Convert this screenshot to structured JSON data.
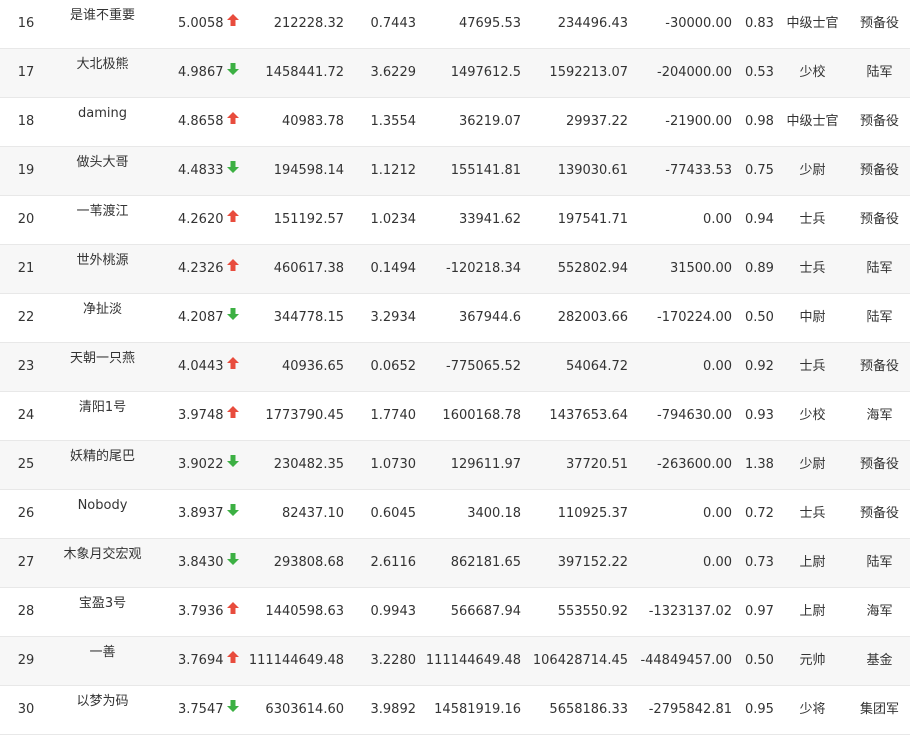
{
  "colors": {
    "up": "#e84c3d",
    "down": "#3cb043"
  },
  "rows": [
    {
      "rank": "16",
      "name": "是谁不重要",
      "score": "5.0058",
      "trend": "up",
      "assets": "212228.32",
      "ratio": "0.7443",
      "profit": "47695.53",
      "value": "234496.43",
      "flow": "-30000.00",
      "pos": "0.83",
      "rank_title": "中级士官",
      "unit": "预备役"
    },
    {
      "rank": "17",
      "name": "大北极熊",
      "score": "4.9867",
      "trend": "down",
      "assets": "1458441.72",
      "ratio": "3.6229",
      "profit": "1497612.5",
      "value": "1592213.07",
      "flow": "-204000.00",
      "pos": "0.53",
      "rank_title": "少校",
      "unit": "陆军"
    },
    {
      "rank": "18",
      "name": "daming",
      "score": "4.8658",
      "trend": "up",
      "assets": "40983.78",
      "ratio": "1.3554",
      "profit": "36219.07",
      "value": "29937.22",
      "flow": "-21900.00",
      "pos": "0.98",
      "rank_title": "中级士官",
      "unit": "预备役"
    },
    {
      "rank": "19",
      "name": "做头大哥",
      "score": "4.4833",
      "trend": "down",
      "assets": "194598.14",
      "ratio": "1.1212",
      "profit": "155141.81",
      "value": "139030.61",
      "flow": "-77433.53",
      "pos": "0.75",
      "rank_title": "少尉",
      "unit": "预备役"
    },
    {
      "rank": "20",
      "name": "一苇渡江",
      "score": "4.2620",
      "trend": "up",
      "assets": "151192.57",
      "ratio": "1.0234",
      "profit": "33941.62",
      "value": "197541.71",
      "flow": "0.00",
      "pos": "0.94",
      "rank_title": "士兵",
      "unit": "预备役"
    },
    {
      "rank": "21",
      "name": "世外桃源",
      "score": "4.2326",
      "trend": "up",
      "assets": "460617.38",
      "ratio": "0.1494",
      "profit": "-120218.34",
      "value": "552802.94",
      "flow": "31500.00",
      "pos": "0.89",
      "rank_title": "士兵",
      "unit": "陆军"
    },
    {
      "rank": "22",
      "name": "净扯淡",
      "score": "4.2087",
      "trend": "down",
      "assets": "344778.15",
      "ratio": "3.2934",
      "profit": "367944.6",
      "value": "282003.66",
      "flow": "-170224.00",
      "pos": "0.50",
      "rank_title": "中尉",
      "unit": "陆军"
    },
    {
      "rank": "23",
      "name": "天朝一只燕",
      "score": "4.0443",
      "trend": "up",
      "assets": "40936.65",
      "ratio": "0.0652",
      "profit": "-775065.52",
      "value": "54064.72",
      "flow": "0.00",
      "pos": "0.92",
      "rank_title": "士兵",
      "unit": "预备役"
    },
    {
      "rank": "24",
      "name": "清阳1号",
      "score": "3.9748",
      "trend": "up",
      "assets": "1773790.45",
      "ratio": "1.7740",
      "profit": "1600168.78",
      "value": "1437653.64",
      "flow": "-794630.00",
      "pos": "0.93",
      "rank_title": "少校",
      "unit": "海军"
    },
    {
      "rank": "25",
      "name": "妖精的尾巴",
      "score": "3.9022",
      "trend": "down",
      "assets": "230482.35",
      "ratio": "1.0730",
      "profit": "129611.97",
      "value": "37720.51",
      "flow": "-263600.00",
      "pos": "1.38",
      "rank_title": "少尉",
      "unit": "预备役"
    },
    {
      "rank": "26",
      "name": "Nobody",
      "score": "3.8937",
      "trend": "down",
      "assets": "82437.10",
      "ratio": "0.6045",
      "profit": "3400.18",
      "value": "110925.37",
      "flow": "0.00",
      "pos": "0.72",
      "rank_title": "士兵",
      "unit": "预备役"
    },
    {
      "rank": "27",
      "name": "木象月交宏观",
      "score": "3.8430",
      "trend": "down",
      "assets": "293808.68",
      "ratio": "2.6116",
      "profit": "862181.65",
      "value": "397152.22",
      "flow": "0.00",
      "pos": "0.73",
      "rank_title": "上尉",
      "unit": "陆军"
    },
    {
      "rank": "28",
      "name": "宝盈3号",
      "score": "3.7936",
      "trend": "up",
      "assets": "1440598.63",
      "ratio": "0.9943",
      "profit": "566687.94",
      "value": "553550.92",
      "flow": "-1323137.02",
      "pos": "0.97",
      "rank_title": "上尉",
      "unit": "海军"
    },
    {
      "rank": "29",
      "name": "一善",
      "score": "3.7694",
      "trend": "up",
      "assets": "111144649.48",
      "ratio": "3.2280",
      "profit": "111144649.48",
      "value": "106428714.45",
      "flow": "-44849457.00",
      "pos": "0.50",
      "rank_title": "元帅",
      "unit": "基金"
    },
    {
      "rank": "30",
      "name": "以梦为码",
      "score": "3.7547",
      "trend": "down",
      "assets": "6303614.60",
      "ratio": "3.9892",
      "profit": "14581919.16",
      "value": "5658186.33",
      "flow": "-2795842.81",
      "pos": "0.95",
      "rank_title": "少将",
      "unit": "集团军"
    }
  ]
}
